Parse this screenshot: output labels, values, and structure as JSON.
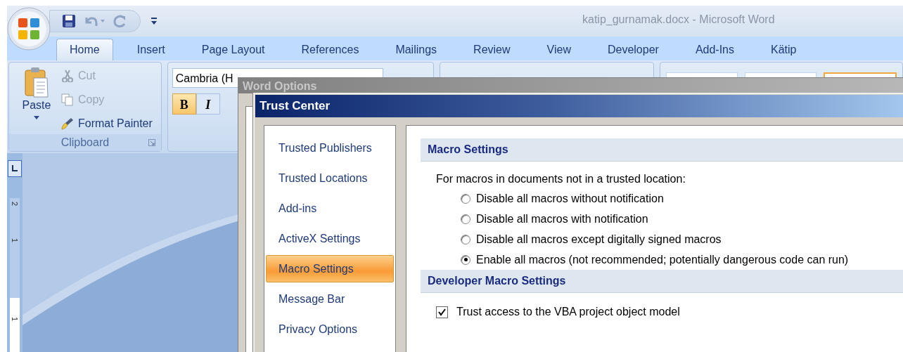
{
  "window": {
    "title": "katip_gurnamak.docx - Microsoft Word"
  },
  "tabs": [
    {
      "label": "Home",
      "selected": true
    },
    {
      "label": "Insert",
      "selected": false
    },
    {
      "label": "Page Layout",
      "selected": false
    },
    {
      "label": "References",
      "selected": false
    },
    {
      "label": "Mailings",
      "selected": false
    },
    {
      "label": "Review",
      "selected": false
    },
    {
      "label": "View",
      "selected": false
    },
    {
      "label": "Developer",
      "selected": false
    },
    {
      "label": "Add-Ins",
      "selected": false
    },
    {
      "label": "Kätip",
      "selected": false
    }
  ],
  "clipboard": {
    "paste": "Paste",
    "label": "Clipboard",
    "items": [
      {
        "kind": "cut",
        "label": "Cut",
        "disabled": true
      },
      {
        "kind": "copy",
        "label": "Copy",
        "disabled": true
      },
      {
        "kind": "painter",
        "label": "Format Painter",
        "disabled": false
      }
    ]
  },
  "font": {
    "name": "Cambria (H",
    "format_buttons": [
      {
        "label": "B",
        "on": true
      },
      {
        "label": "I",
        "on": false
      }
    ]
  },
  "ruler": {
    "labels": [
      "2",
      "1",
      "1"
    ]
  },
  "word_options": {
    "title": "Word Options"
  },
  "trust_center": {
    "title": "Trust Center",
    "nav": [
      {
        "label": "Trusted Publishers",
        "selected": false
      },
      {
        "label": "Trusted Locations",
        "selected": false
      },
      {
        "label": "Add-ins",
        "selected": false
      },
      {
        "label": "ActiveX Settings",
        "selected": false
      },
      {
        "label": "Macro Settings",
        "selected": true
      },
      {
        "label": "Message Bar",
        "selected": false
      },
      {
        "label": "Privacy Options",
        "selected": false
      }
    ],
    "sections": [
      {
        "heading": "Macro Settings",
        "intro": "For macros in documents not in a trusted location:",
        "options": [
          {
            "label": "Disable all macros without notification",
            "selected": false
          },
          {
            "label": "Disable all macros with notification",
            "selected": false
          },
          {
            "label": "Disable all macros except digitally signed macros",
            "selected": false
          },
          {
            "label": "Enable all macros (not recommended; potentially dangerous code can run)",
            "selected": true
          }
        ]
      },
      {
        "heading": "Developer Macro Settings",
        "checkboxes": [
          {
            "label": "Trust access to the VBA project object model",
            "checked": true
          }
        ]
      }
    ]
  }
}
